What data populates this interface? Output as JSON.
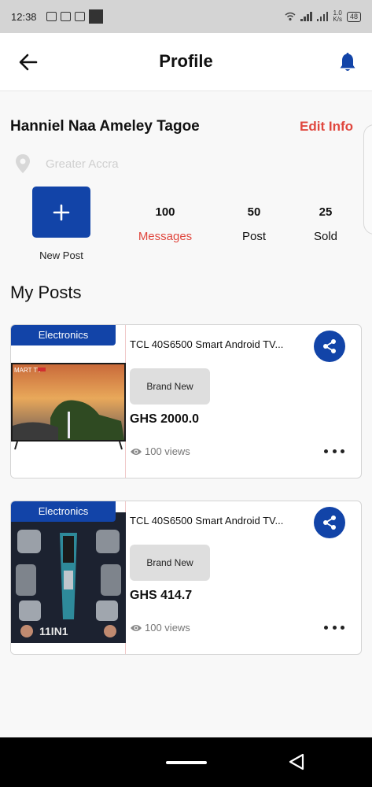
{
  "status_bar": {
    "time": "12:38",
    "speed_value": "1.0",
    "speed_unit": "K/s",
    "battery": "48"
  },
  "header": {
    "title": "Profile",
    "back_icon": "arrow-left-icon",
    "notification_icon": "bell-icon"
  },
  "profile": {
    "name": "Hanniel Naa Ameley Tagoe",
    "edit_label": "Edit Info",
    "location": "Greater Accra",
    "new_post_label": "New Post"
  },
  "stats": [
    {
      "value": "100",
      "label": "Messages"
    },
    {
      "value": "50",
      "label": "Post"
    },
    {
      "value": "25",
      "label": "Sold"
    }
  ],
  "section": {
    "title": "My Posts"
  },
  "posts": [
    {
      "category": "Electronics",
      "title": "TCL 40S6500 Smart Android TV...",
      "condition": "Brand New",
      "price": "GHS 2000.0",
      "views": "100 views",
      "image_text": "MART TV"
    },
    {
      "category": "Electronics",
      "title": "TCL 40S6500 Smart Android TV...",
      "condition": "Brand New",
      "price": "GHS 414.7",
      "views": "100 views",
      "image_text": "11IN1"
    }
  ],
  "colors": {
    "primary": "#1244a8",
    "accent_red": "#e0473e"
  }
}
